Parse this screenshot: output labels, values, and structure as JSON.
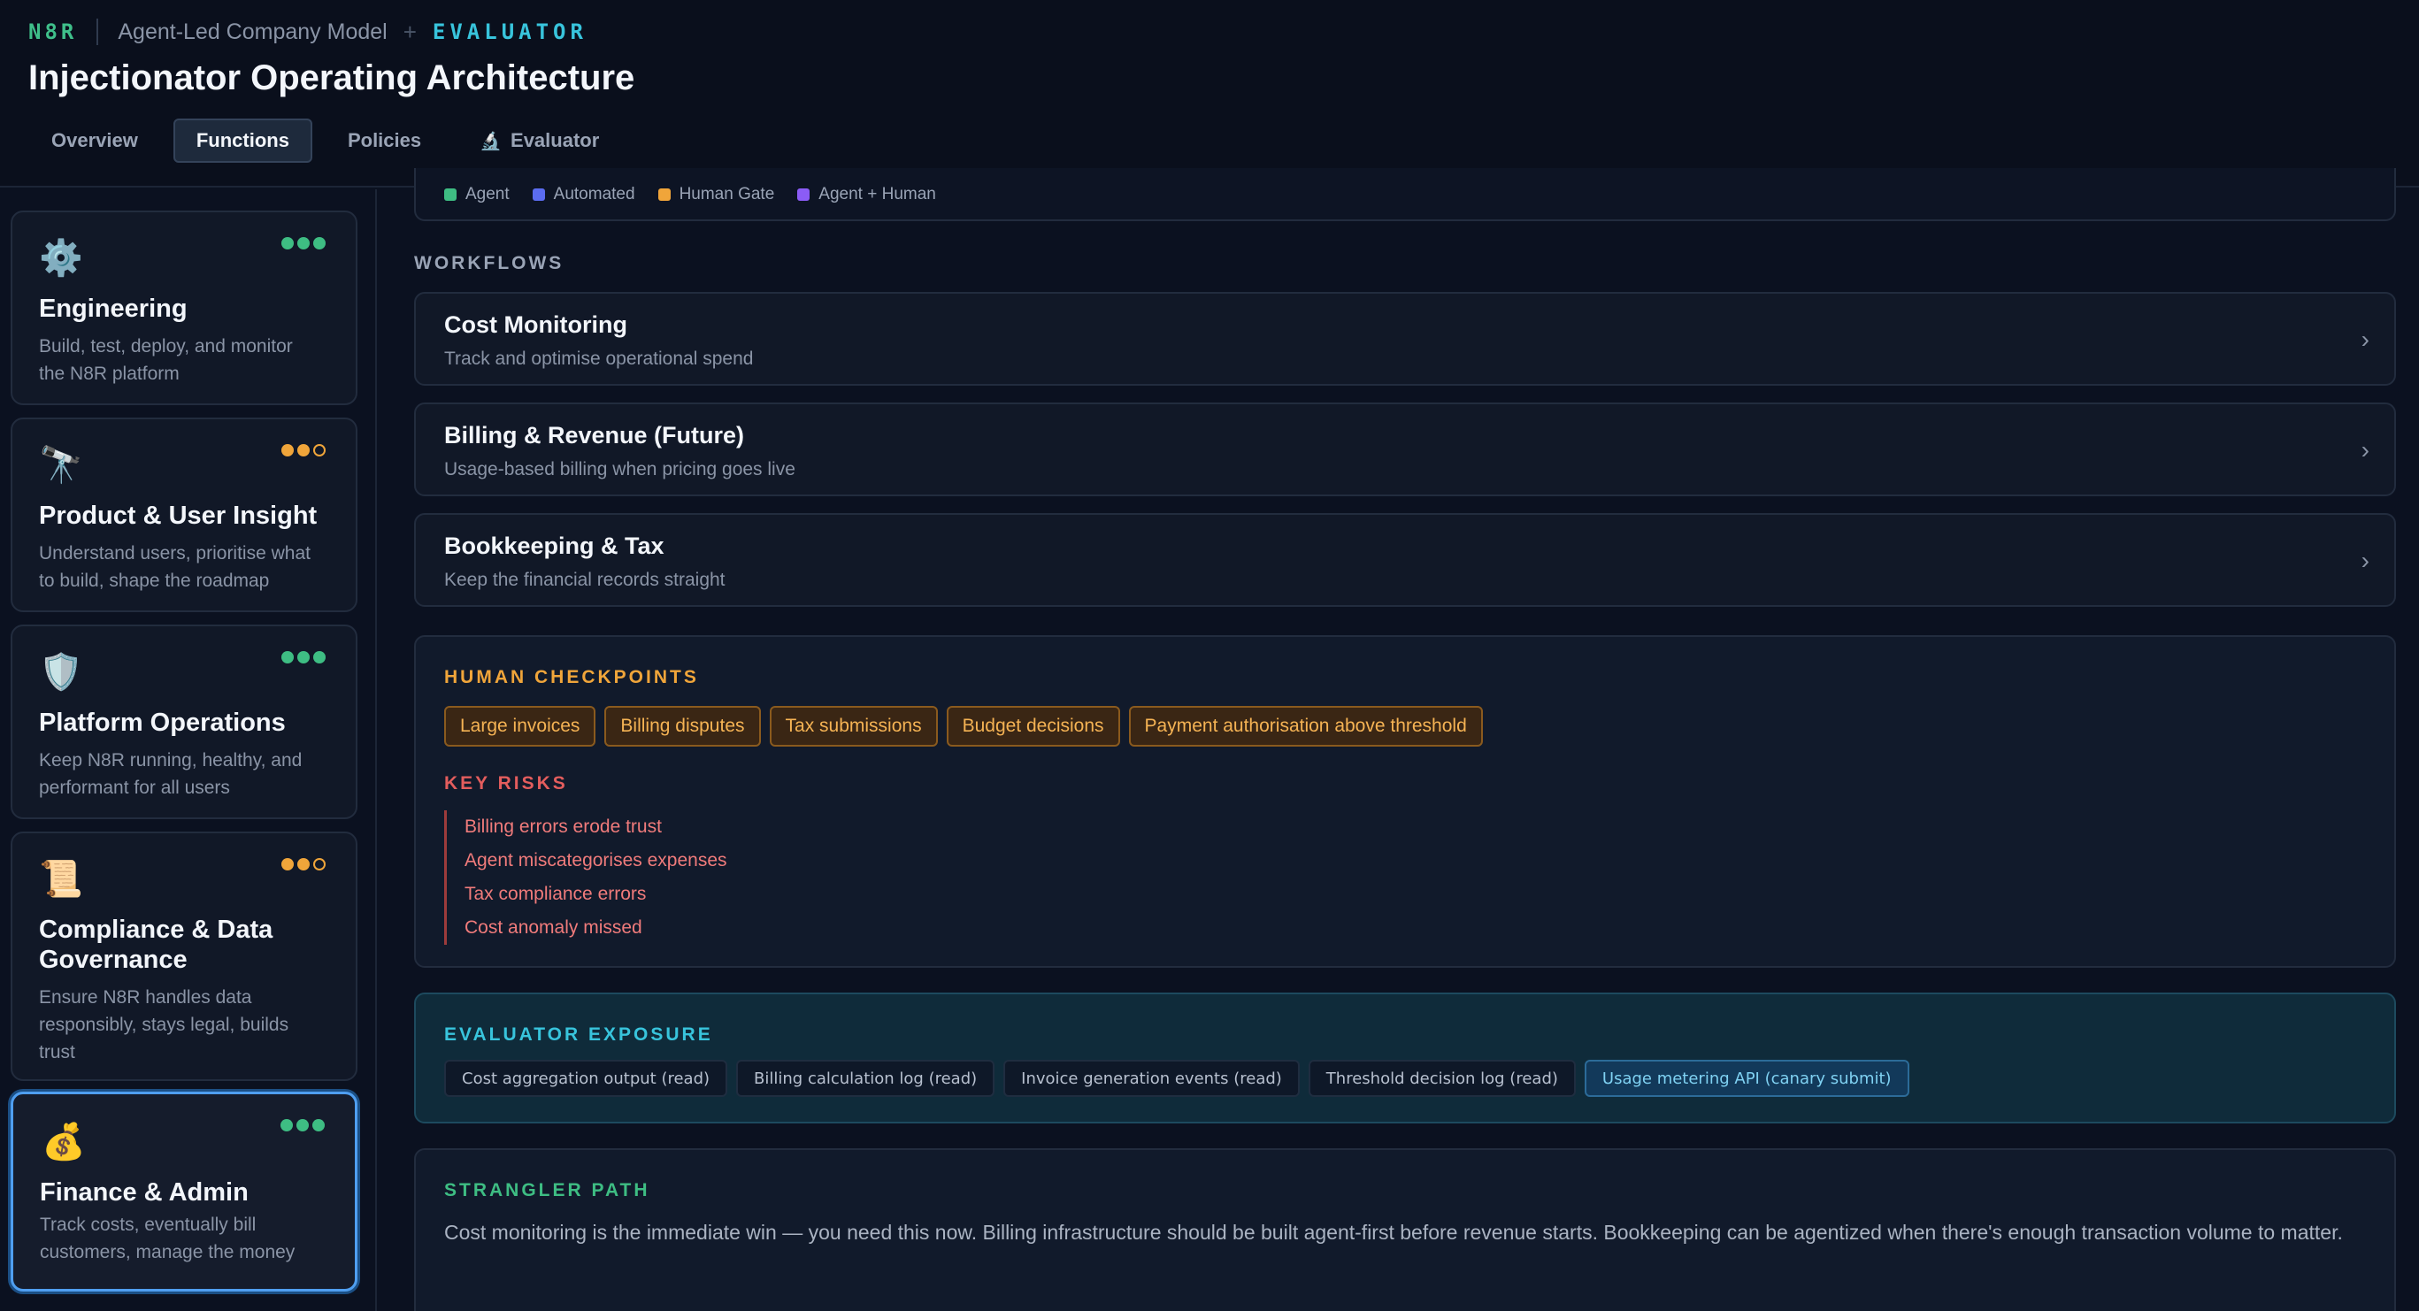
{
  "header": {
    "brand": "N8R",
    "model": "Agent-Led Company Model",
    "plus": "+",
    "evaluator": "EVALUATOR",
    "title": "Injectionator Operating Architecture",
    "tabs": [
      {
        "label": "Overview",
        "active": false
      },
      {
        "label": "Functions",
        "active": true
      },
      {
        "label": "Policies",
        "active": false
      },
      {
        "label": "Evaluator",
        "icon": "microscope-icon",
        "glyph": "🔬",
        "active": false
      }
    ]
  },
  "sidebar": {
    "cards": [
      {
        "title": "Engineering",
        "description": "Build, test, deploy, and monitor the N8R platform",
        "icon": "gear-icon",
        "glyph": "⚙️",
        "maturity": 3,
        "status_color": "#3ebd83"
      },
      {
        "title": "Product & User Insight",
        "description": "Understand users, prioritise what to build, shape the roadmap",
        "icon": "telescope-icon",
        "glyph": "🔭",
        "maturity": 2,
        "status_color": "#f0a53a"
      },
      {
        "title": "Platform Operations",
        "description": "Keep N8R running, healthy, and performant for all users",
        "icon": "shield-icon",
        "glyph": "🛡️",
        "maturity": 3,
        "status_color": "#3ebd83"
      },
      {
        "title": "Compliance & Data Governance",
        "description": "Ensure N8R handles data responsibly, stays legal, builds trust",
        "icon": "scroll-icon",
        "glyph": "📜",
        "maturity": 2,
        "status_color": "#f0a53a"
      },
      {
        "title": "Finance & Admin",
        "description": "Track costs, eventually bill customers, manage the money",
        "icon": "money-bag-icon",
        "glyph": "💰",
        "maturity": 3,
        "status_color": "#3ebd83",
        "selected": true
      }
    ]
  },
  "legend": [
    {
      "label": "Agent",
      "color": "#3ebd83"
    },
    {
      "label": "Automated",
      "color": "#5b6cf0"
    },
    {
      "label": "Human Gate",
      "color": "#f0a53a"
    },
    {
      "label": "Agent + Human",
      "color": "#8b5cf6"
    }
  ],
  "workflows": {
    "label": "WORKFLOWS",
    "items": [
      {
        "title": "Cost Monitoring",
        "subtitle": "Track and optimise operational spend"
      },
      {
        "title": "Billing & Revenue (Future)",
        "subtitle": "Usage-based billing when pricing goes live"
      },
      {
        "title": "Bookkeeping & Tax",
        "subtitle": "Keep the financial records straight"
      }
    ],
    "chevron": "›"
  },
  "checkpoints": {
    "label": "HUMAN CHECKPOINTS",
    "items": [
      "Large invoices",
      "Billing disputes",
      "Tax submissions",
      "Budget decisions",
      "Payment authorisation above threshold"
    ],
    "risks_label": "KEY RISKS",
    "risks": [
      "Billing errors erode trust",
      "Agent miscategorises expenses",
      "Tax compliance errors",
      "Cost anomaly missed"
    ]
  },
  "exposure": {
    "label": "EVALUATOR EXPOSURE",
    "items": [
      {
        "label": "Cost aggregation output (read)",
        "highlight": false
      },
      {
        "label": "Billing calculation log (read)",
        "highlight": false
      },
      {
        "label": "Invoice generation events (read)",
        "highlight": false
      },
      {
        "label": "Threshold decision log (read)",
        "highlight": false
      },
      {
        "label": "Usage metering API (canary submit)",
        "highlight": true
      }
    ]
  },
  "strangler": {
    "label": "STRANGLER PATH",
    "text": "Cost monitoring is the immediate win — you need this now. Billing infrastructure should be built agent-first before revenue starts. Bookkeeping can be agentized when there's enough transaction volume to matter."
  }
}
